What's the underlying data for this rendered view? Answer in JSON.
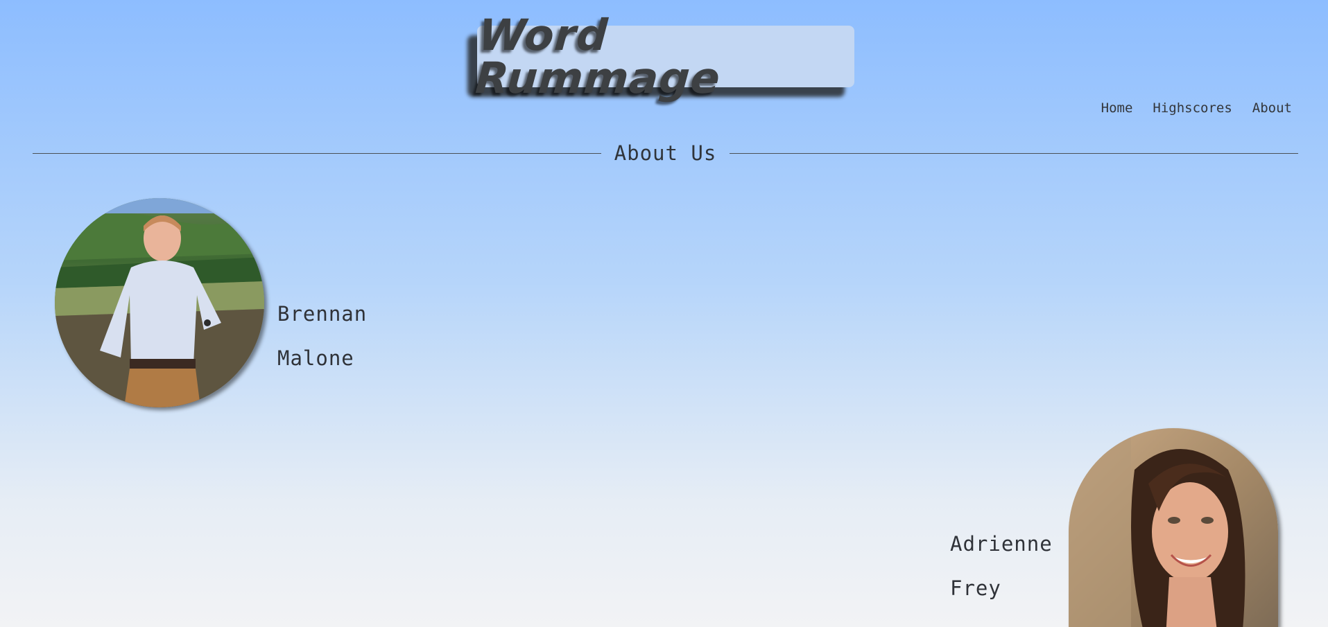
{
  "header": {
    "logo_text": "Word Rummage"
  },
  "nav": {
    "items": [
      "Home",
      "Highscores",
      "About"
    ]
  },
  "main": {
    "section_title": "About Us",
    "members": [
      {
        "first_name": "Brennan",
        "last_name": "Malone"
      },
      {
        "first_name": "Adrienne",
        "last_name": "Frey"
      }
    ]
  }
}
